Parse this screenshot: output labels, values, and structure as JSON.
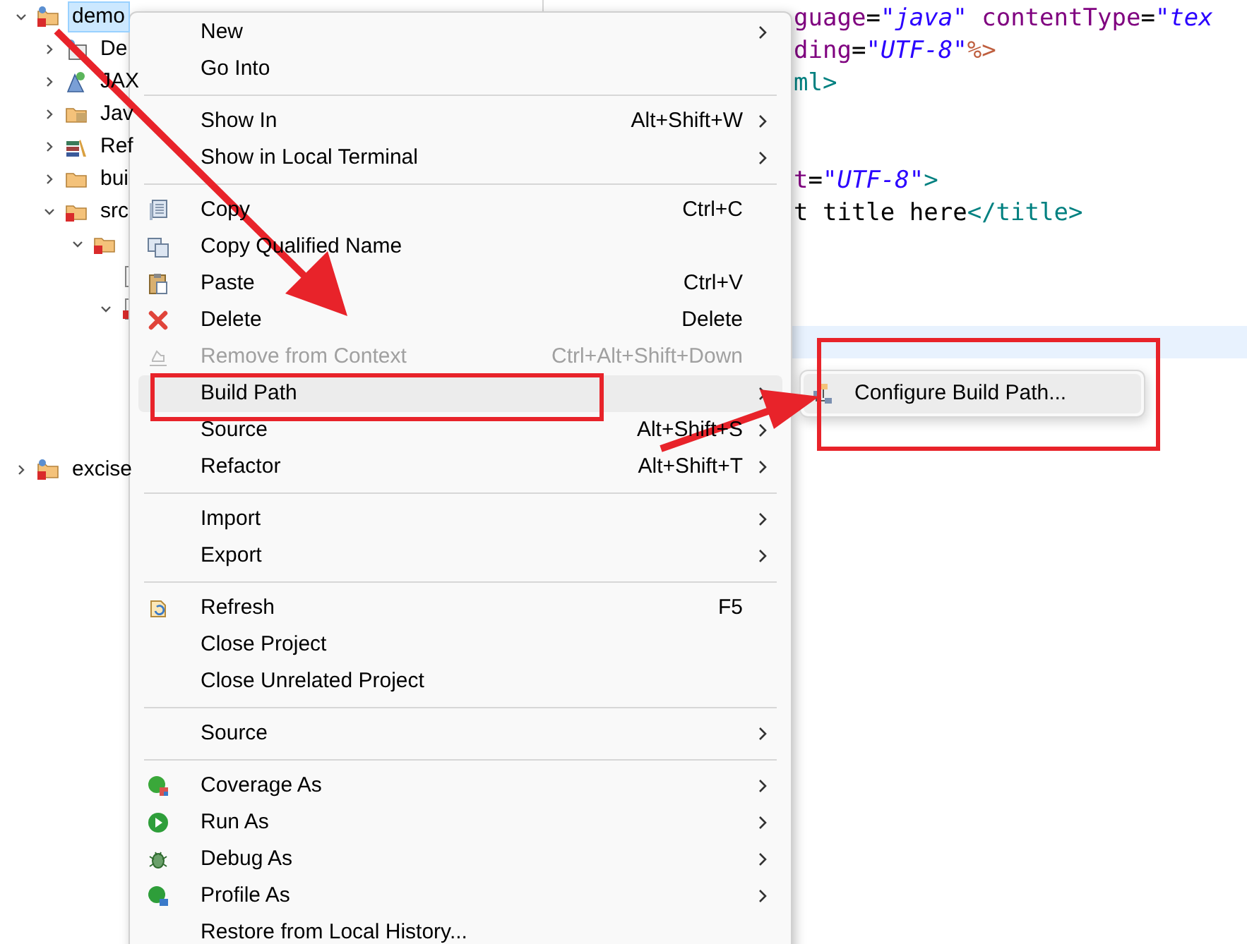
{
  "tree": [
    {
      "label": "demo",
      "selected": true,
      "expanded": true,
      "kind": "project",
      "children": [
        {
          "label": "De",
          "expanded": false,
          "kind": "library"
        },
        {
          "label": "JAX",
          "expanded": false,
          "kind": "service"
        },
        {
          "label": "Jav",
          "expanded": false,
          "kind": "resources"
        },
        {
          "label": "Ref",
          "expanded": false,
          "kind": "books"
        },
        {
          "label": "bui",
          "expanded": false,
          "kind": "folder"
        },
        {
          "label": "src",
          "expanded": true,
          "kind": "errfolder",
          "children": [
            {
              "expanded": true,
              "kind": "errfolder",
              "children": [
                {
                  "kind": "file"
                },
                {
                  "expanded": true,
                  "kind": "errfile"
                }
              ]
            }
          ]
        }
      ]
    },
    {
      "label": "excise",
      "selected": false,
      "expanded": false,
      "kind": "project"
    }
  ],
  "editor_lines": [
    {
      "current": false,
      "tokens": [
        {
          "text": "guage",
          "kind": "attr"
        },
        {
          "text": "=",
          "kind": "plain"
        },
        {
          "text": "\"java\"",
          "kind": "value"
        },
        {
          "text": " contentType",
          "kind": "attr"
        },
        {
          "text": "=",
          "kind": "plain"
        },
        {
          "text": "\"tex",
          "kind": "value"
        }
      ]
    },
    {
      "current": false,
      "tokens": [
        {
          "text": "ding",
          "kind": "attr"
        },
        {
          "text": "=",
          "kind": "plain"
        },
        {
          "text": "\"UTF-8\"",
          "kind": "value"
        },
        {
          "text": "%>",
          "kind": "directive"
        }
      ]
    },
    {
      "current": false,
      "tokens": [
        {
          "text": "ml",
          "kind": "tag"
        },
        {
          "text": ">",
          "kind": "tag"
        }
      ]
    },
    {
      "current": false
    },
    {
      "current": false
    },
    {
      "current": false,
      "tokens": [
        {
          "text": "t",
          "kind": "attr"
        },
        {
          "text": "=",
          "kind": "plain"
        },
        {
          "text": "\"UTF-8\"",
          "kind": "value"
        },
        {
          "text": ">",
          "kind": "tag"
        }
      ]
    },
    {
      "current": false,
      "tokens": [
        {
          "text": "t title here",
          "kind": "plain"
        },
        {
          "text": "</title>",
          "kind": "tag"
        }
      ]
    },
    {
      "current": false
    },
    {
      "current": false
    },
    {
      "current": false
    },
    {
      "current": true
    }
  ],
  "menu": [
    {
      "kind": "item",
      "label": "New",
      "submenu": true,
      "disabled": false,
      "selected": false
    },
    {
      "kind": "item",
      "label": "Go Into",
      "submenu": false,
      "disabled": false,
      "selected": false
    },
    {
      "kind": "separator"
    },
    {
      "kind": "item",
      "label": "Show In",
      "shortcut": "Alt+Shift+W",
      "submenu": true,
      "disabled": false,
      "selected": false
    },
    {
      "kind": "item",
      "label": "Show in Local Terminal",
      "submenu": true,
      "disabled": false,
      "selected": false
    },
    {
      "kind": "separator"
    },
    {
      "kind": "item",
      "label": "Copy",
      "shortcut": "Ctrl+C",
      "submenu": false,
      "disabled": false,
      "selected": false
    },
    {
      "kind": "item",
      "label": "Copy Qualified Name",
      "submenu": false,
      "disabled": false,
      "selected": false
    },
    {
      "kind": "item",
      "label": "Paste",
      "shortcut": "Ctrl+V",
      "submenu": false,
      "disabled": false,
      "selected": false
    },
    {
      "kind": "item",
      "label": "Delete",
      "shortcut": "Delete",
      "submenu": false,
      "disabled": false,
      "selected": false
    },
    {
      "kind": "item",
      "label": "Remove from Context",
      "shortcut": "Ctrl+Alt+Shift+Down",
      "submenu": false,
      "disabled": true,
      "selected": false
    },
    {
      "kind": "item",
      "label": "Build Path",
      "submenu": true,
      "disabled": false,
      "selected": true
    },
    {
      "kind": "item",
      "label": "Source",
      "shortcut": "Alt+Shift+S",
      "submenu": true,
      "disabled": false,
      "selected": false
    },
    {
      "kind": "item",
      "label": "Refactor",
      "shortcut": "Alt+Shift+T",
      "submenu": true,
      "disabled": false,
      "selected": false
    },
    {
      "kind": "separator"
    },
    {
      "kind": "item",
      "label": "Import",
      "submenu": true,
      "disabled": false,
      "selected": false
    },
    {
      "kind": "item",
      "label": "Export",
      "submenu": true,
      "disabled": false,
      "selected": false
    },
    {
      "kind": "separator"
    },
    {
      "kind": "item",
      "label": "Refresh",
      "shortcut": "F5",
      "submenu": false,
      "disabled": false,
      "selected": false
    },
    {
      "kind": "item",
      "label": "Close Project",
      "submenu": false,
      "disabled": false,
      "selected": false
    },
    {
      "kind": "item",
      "label": "Close Unrelated Project",
      "submenu": false,
      "disabled": false,
      "selected": false
    },
    {
      "kind": "separator"
    },
    {
      "kind": "item",
      "label": "Source",
      "submenu": true,
      "disabled": false,
      "selected": false
    },
    {
      "kind": "separator"
    },
    {
      "kind": "item",
      "label": "Coverage As",
      "submenu": true,
      "disabled": false,
      "selected": false
    },
    {
      "kind": "item",
      "label": "Run As",
      "submenu": true,
      "disabled": false,
      "selected": false
    },
    {
      "kind": "item",
      "label": "Debug As",
      "submenu": true,
      "disabled": false,
      "selected": false
    },
    {
      "kind": "item",
      "label": "Profile As",
      "submenu": true,
      "disabled": false,
      "selected": false
    },
    {
      "kind": "item",
      "label": "Restore from Local History...",
      "submenu": false,
      "disabled": false,
      "selected": false
    }
  ],
  "submenu": [
    {
      "label": "Configure Build Path...",
      "selected": true
    }
  ]
}
